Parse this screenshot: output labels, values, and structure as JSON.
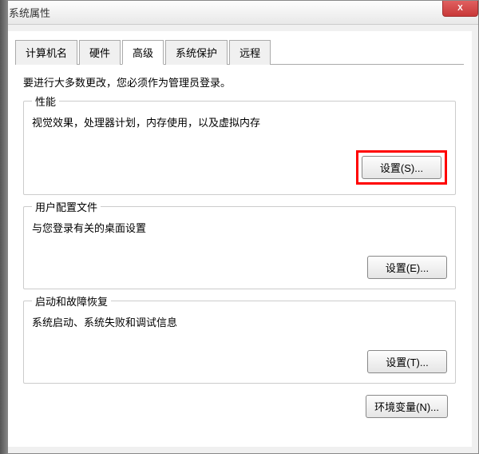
{
  "window": {
    "title": "系统属性",
    "close_label": "X"
  },
  "tabs": {
    "computer_name": "计算机名",
    "hardware": "硬件",
    "advanced": "高级",
    "system_protection": "系统保护",
    "remote": "远程"
  },
  "intro": "要进行大多数更改，您必须作为管理员登录。",
  "groups": {
    "performance": {
      "title": "性能",
      "desc": "视觉效果，处理器计划，内存使用，以及虚拟内存",
      "button": "设置(S)..."
    },
    "user_profiles": {
      "title": "用户配置文件",
      "desc": "与您登录有关的桌面设置",
      "button": "设置(E)..."
    },
    "startup_recovery": {
      "title": "启动和故障恢复",
      "desc": "系统启动、系统失败和调试信息",
      "button": "设置(T)..."
    }
  },
  "env_button": "环境变量(N)..."
}
